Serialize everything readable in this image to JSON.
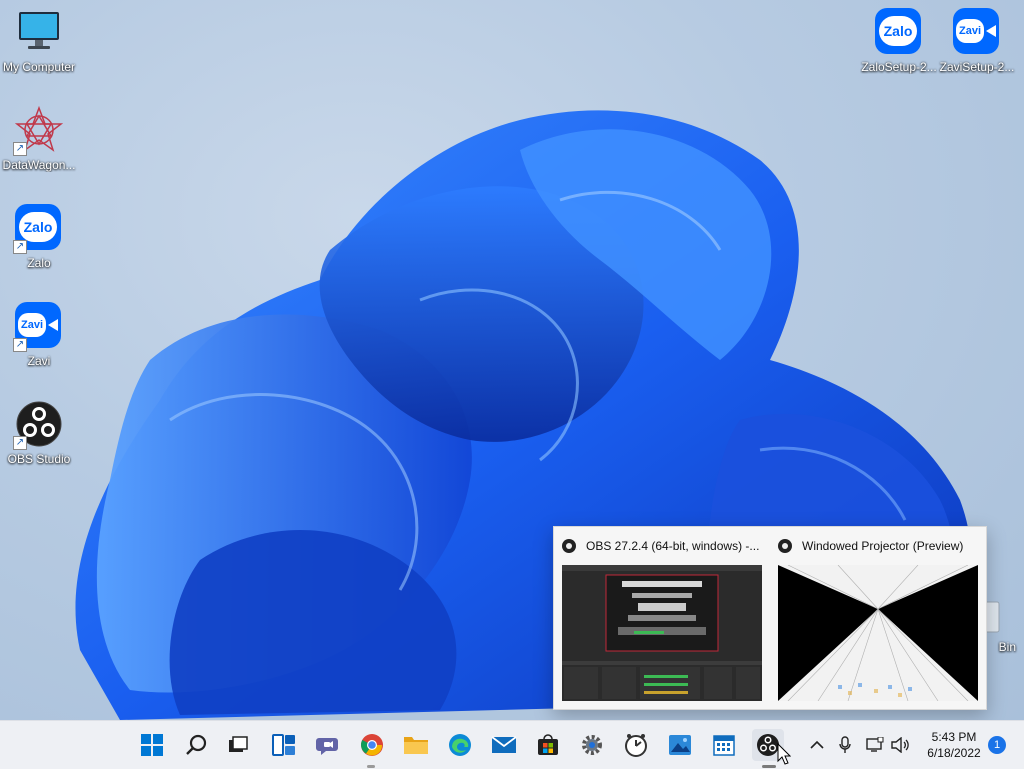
{
  "desktop_icons": [
    {
      "label": "My Computer",
      "icon": "monitor-icon",
      "shortcut": false
    },
    {
      "label": "DataWagon...",
      "icon": "datawagon-icon",
      "shortcut": true
    },
    {
      "label": "Zalo",
      "icon": "zalo-icon",
      "shortcut": true
    },
    {
      "label": "Zavi",
      "icon": "zavi-icon",
      "shortcut": true
    },
    {
      "label": "OBS Studio",
      "icon": "obs-icon",
      "shortcut": true
    },
    {
      "label": "ZaloSetup-2...",
      "icon": "zalo-icon",
      "shortcut": false
    },
    {
      "label": "ZaviSetup-2...",
      "icon": "zavi-icon",
      "shortcut": false
    },
    {
      "label": "Bin",
      "icon": "recycle-bin-icon",
      "shortcut": false
    }
  ],
  "zalo_text": "Zalo",
  "zavi_text": "Zavi",
  "taskbar_preview": {
    "windows": [
      {
        "title": "OBS 27.2.4 (64-bit, windows) -...",
        "icon": "obs-icon"
      },
      {
        "title": "Windowed Projector (Preview)",
        "icon": "obs-icon"
      }
    ]
  },
  "taskbar": {
    "pinned": [
      "start-icon",
      "search-icon",
      "task-view-icon",
      "widgets-icon",
      "teams-chat-icon",
      "chrome-icon",
      "file-explorer-icon",
      "edge-icon",
      "mail-icon",
      "store-icon",
      "settings-icon",
      "clock-app-icon",
      "photos-icon",
      "calendar-icon",
      "obs-icon"
    ],
    "active_app": "obs-icon"
  },
  "tray": {
    "clock_time": "5:43 PM",
    "clock_date": "6/18/2022",
    "notification_count": "1",
    "icons": [
      "chevron-up-icon",
      "microphone-icon",
      "network-icon",
      "speaker-icon"
    ]
  },
  "colors": {
    "accent": "#0078d4",
    "wallpaper_blue": "#1658e8",
    "taskbar_bg": "#eef0f4"
  }
}
